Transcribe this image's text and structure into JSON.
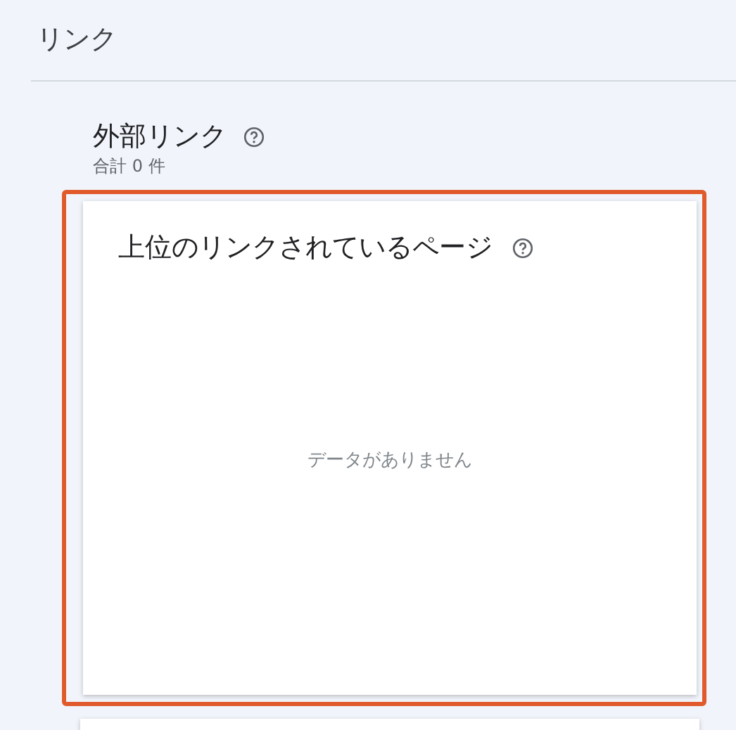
{
  "page_title": "リンク",
  "section": {
    "title": "外部リンク",
    "subtitle": "合計 0 件"
  },
  "card": {
    "title": "上位のリンクされているページ",
    "empty_message": "データがありません",
    "highlighted": true
  }
}
